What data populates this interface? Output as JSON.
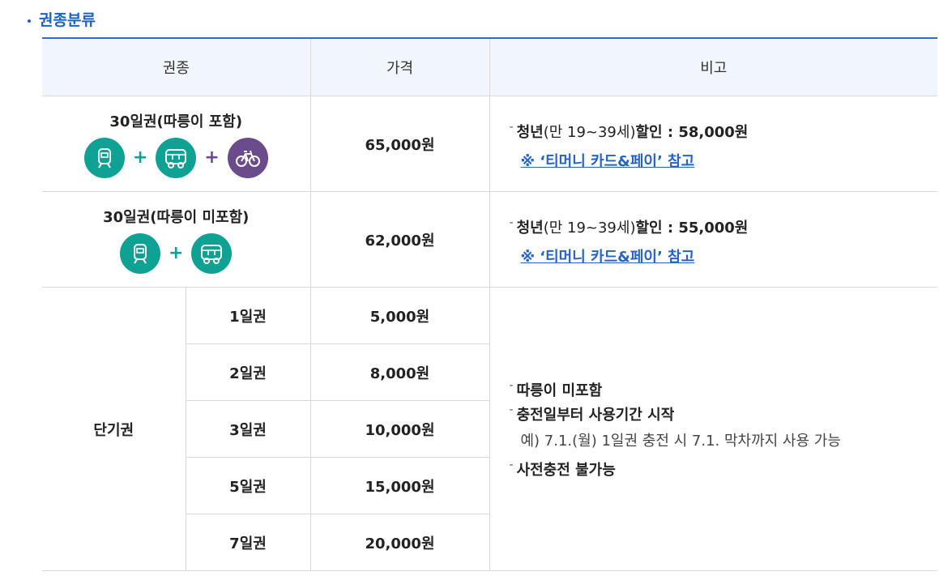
{
  "section": {
    "title": "권종분류"
  },
  "table": {
    "headers": [
      "권종",
      "가격",
      "비고"
    ],
    "rows30": [
      {
        "name": "30일권(따릉이 포함)",
        "price": "65,000원",
        "note_dash": "-",
        "note_bold1": "청년",
        "note_paren": "(만 19~39세)",
        "note_bold2": "할인 : 58,000원",
        "link": "※ ‘티머니 카드&페이’ 참고"
      },
      {
        "name": "30일권(따릉이 미포함)",
        "price": "62,000원",
        "note_dash": "-",
        "note_bold1": "청년",
        "note_paren": "(만 19~39세)",
        "note_bold2": "할인 : 55,000원",
        "link": "※ ‘티머니 카드&페이’ 참고"
      }
    ],
    "short_term": {
      "label": "단기권",
      "items": [
        {
          "name": "1일권",
          "price": "5,000원"
        },
        {
          "name": "2일권",
          "price": "8,000원"
        },
        {
          "name": "3일권",
          "price": "10,000원"
        },
        {
          "name": "5일권",
          "price": "15,000원"
        },
        {
          "name": "7일권",
          "price": "20,000원"
        }
      ],
      "notes": {
        "n1": "따릉이 미포함",
        "n2": "충전일부터 사용기간 시작",
        "example": "예) 7.1.(월) 1일권 충전 시 7.1. 막차까지 사용 가능",
        "n3": "사전충전 불가능"
      }
    }
  },
  "icons": {
    "subway": "subway-icon",
    "bus": "bus-icon",
    "bike": "bicycle-icon",
    "plus": "+"
  },
  "colors": {
    "accent": "#1a63c6",
    "teal": "#0fa294",
    "purple": "#6a4c8c",
    "header_bg": "#f1f6fc",
    "link": "#2563c7"
  }
}
